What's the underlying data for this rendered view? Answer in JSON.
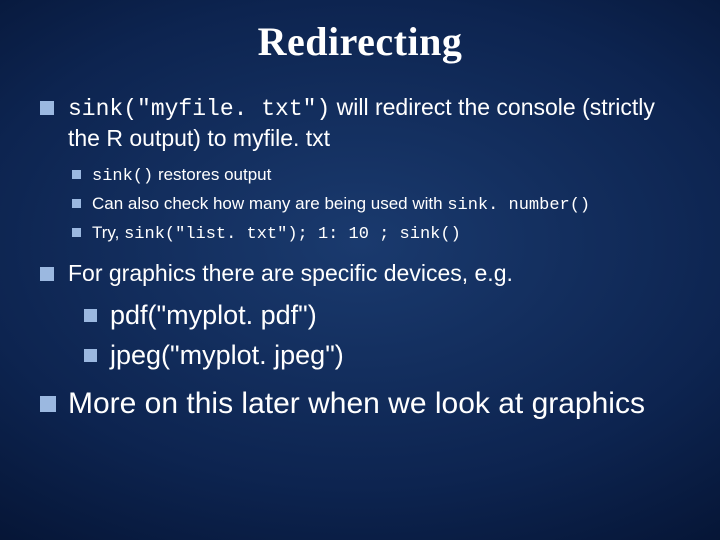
{
  "title": "Redirecting",
  "b1": {
    "code": "sink(\"myfile. txt\")",
    "rest": "  will redirect the console (strictly the R output) to myfile. txt",
    "sub": {
      "s1a": "sink()",
      "s1b": " restores output",
      "s2a": "Can also check how many are being used with ",
      "s2b": "sink. number()",
      "s3a": "Try, ",
      "s3b": "sink(\"list. txt\"); 1: 10 ; sink()"
    }
  },
  "b2": {
    "text": "For graphics there are specific devices, e.g.",
    "sub": {
      "s1": "pdf(\"myplot. pdf\")",
      "s2": "jpeg(\"myplot. jpeg\")"
    }
  },
  "b3": {
    "text": "More on this later when we look at graphics"
  }
}
